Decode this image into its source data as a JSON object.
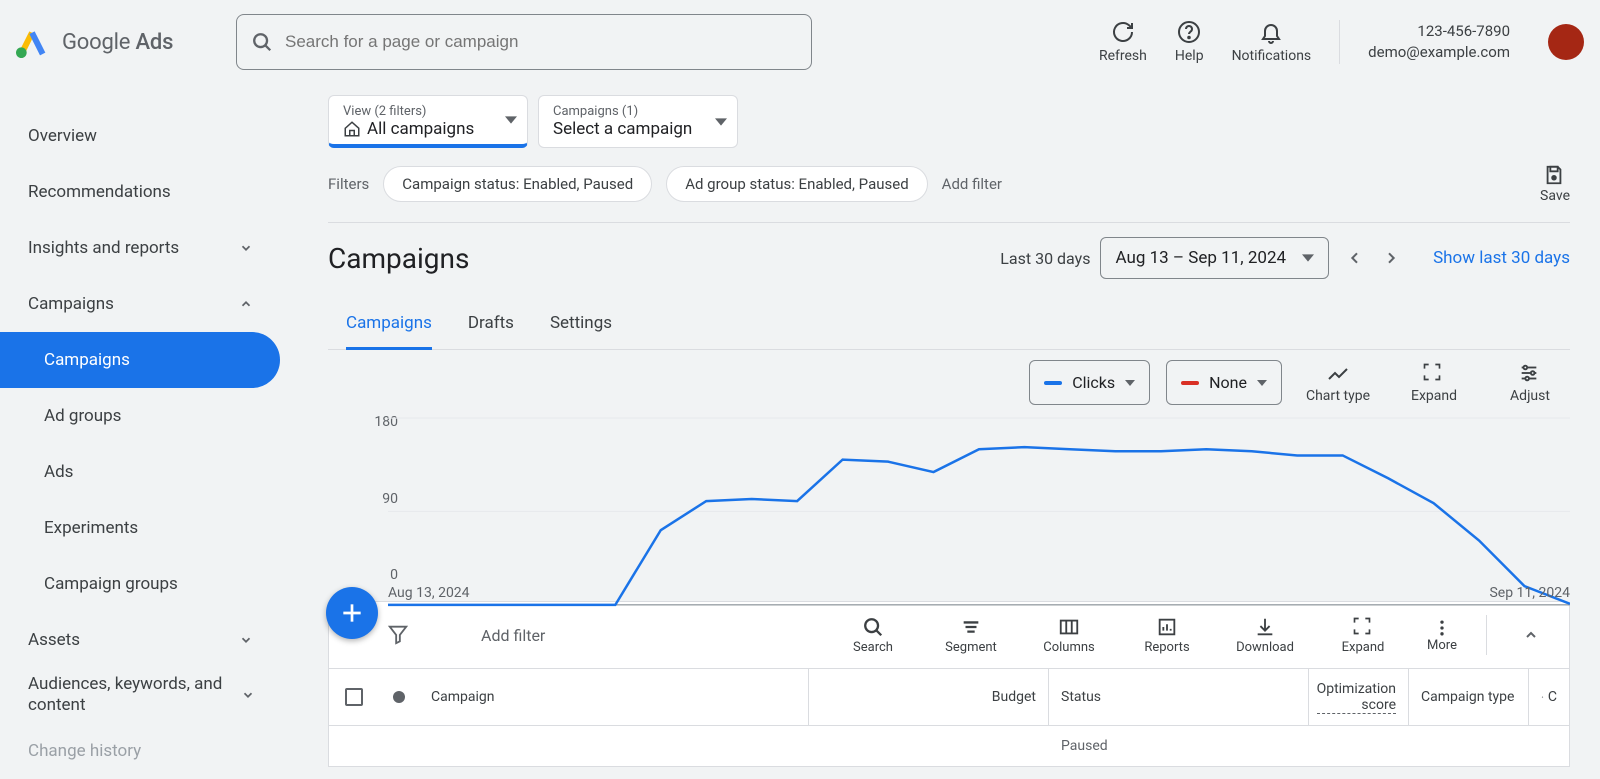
{
  "brand": {
    "name_1": "Google",
    "name_2": " Ads"
  },
  "search": {
    "placeholder": "Search for a page or campaign"
  },
  "header_actions": {
    "refresh": "Refresh",
    "help": "Help",
    "notifications": "Notifications",
    "save": "Save"
  },
  "account": {
    "id": "123-456-7890",
    "email": "demo@example.com"
  },
  "sidebar": {
    "items": [
      {
        "label": "Overview"
      },
      {
        "label": "Recommendations"
      },
      {
        "label": "Insights and reports",
        "chevron": "down"
      },
      {
        "label": "Campaigns",
        "chevron": "up",
        "expanded": true
      },
      {
        "label": "Assets",
        "chevron": "down"
      },
      {
        "label": "Audiences, keywords, and content",
        "chevron": "down"
      },
      {
        "label": "Change history"
      }
    ],
    "sub_items": [
      {
        "label": "Campaigns",
        "active": true
      },
      {
        "label": "Ad groups"
      },
      {
        "label": "Ads"
      },
      {
        "label": "Experiments"
      },
      {
        "label": "Campaign groups"
      }
    ]
  },
  "pickers": {
    "view": {
      "sup": "View (2 filters)",
      "val": "All campaigns"
    },
    "campaign": {
      "sup": "Campaigns (1)",
      "val": "Select a campaign"
    }
  },
  "filters": {
    "label": "Filters",
    "chips": [
      "Campaign status: Enabled, Paused",
      "Ad group status: Enabled, Paused"
    ],
    "add": "Add filter"
  },
  "page_title": "Campaigns",
  "date_range": {
    "label": "Last 30 days",
    "range": "Aug 13 – Sep 11, 2024",
    "show_link": "Show last 30 days",
    "start_label": "Aug 13, 2024",
    "end_label": "Sep 11, 2024"
  },
  "tabs": [
    {
      "label": "Campaigns",
      "active": true
    },
    {
      "label": "Drafts"
    },
    {
      "label": "Settings"
    }
  ],
  "chart_controls": {
    "metric1": {
      "label": "Clicks",
      "color": "#1a73e8"
    },
    "metric2": {
      "label": "None",
      "color": "#d93025"
    },
    "chart_type": "Chart type",
    "expand": "Expand",
    "adjust": "Adjust"
  },
  "chart_data": {
    "type": "line",
    "title": "",
    "xlabel": "",
    "ylabel": "",
    "ylim": [
      0,
      180
    ],
    "y_ticks": [
      0,
      90,
      180
    ],
    "x_range": [
      "Aug 13, 2024",
      "Sep 11, 2024"
    ],
    "series": [
      {
        "name": "Clicks",
        "color": "#1a73e8",
        "values": [
          0,
          0,
          0,
          0,
          0,
          0,
          72,
          100,
          102,
          100,
          140,
          138,
          128,
          150,
          152,
          150,
          148,
          148,
          150,
          148,
          144,
          144,
          122,
          98,
          62,
          18,
          1
        ]
      }
    ]
  },
  "table_toolbar": {
    "add_filter": "Add filter",
    "buttons": {
      "search": "Search",
      "segment": "Segment",
      "columns": "Columns",
      "reports": "Reports",
      "download": "Download",
      "expand": "Expand",
      "more": "More"
    }
  },
  "table": {
    "headers": {
      "campaign": "Campaign",
      "budget": "Budget",
      "status": "Status",
      "opt": "Optimization score",
      "type": "Campaign type",
      "last": "C"
    },
    "rows": [
      {
        "status": "Paused"
      }
    ]
  }
}
